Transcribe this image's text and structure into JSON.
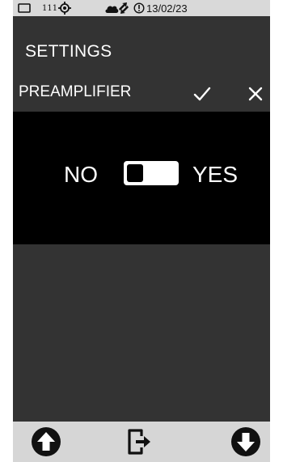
{
  "status_bar": {
    "channel": "111",
    "date": "13/02/23"
  },
  "header": {
    "title": "SETTINGS"
  },
  "param": {
    "name": "PREAMPLIFIER"
  },
  "toggle": {
    "off_label": "NO",
    "on_label": "YES",
    "value": false
  },
  "icons": {
    "battery": "battery-icon",
    "target": "target-icon",
    "cloud": "cloud-icon",
    "sync": "sync-icon",
    "alert": "alert-icon",
    "confirm": "check-icon",
    "cancel": "close-icon",
    "up": "arrow-up-circle-icon",
    "exit": "exit-icon",
    "down": "arrow-down-circle-icon"
  },
  "colors": {
    "screen_bg": "#333333",
    "content_bg": "#000000",
    "status_bg": "#d9d9d9",
    "bottom_bg": "#d6d6d6"
  }
}
